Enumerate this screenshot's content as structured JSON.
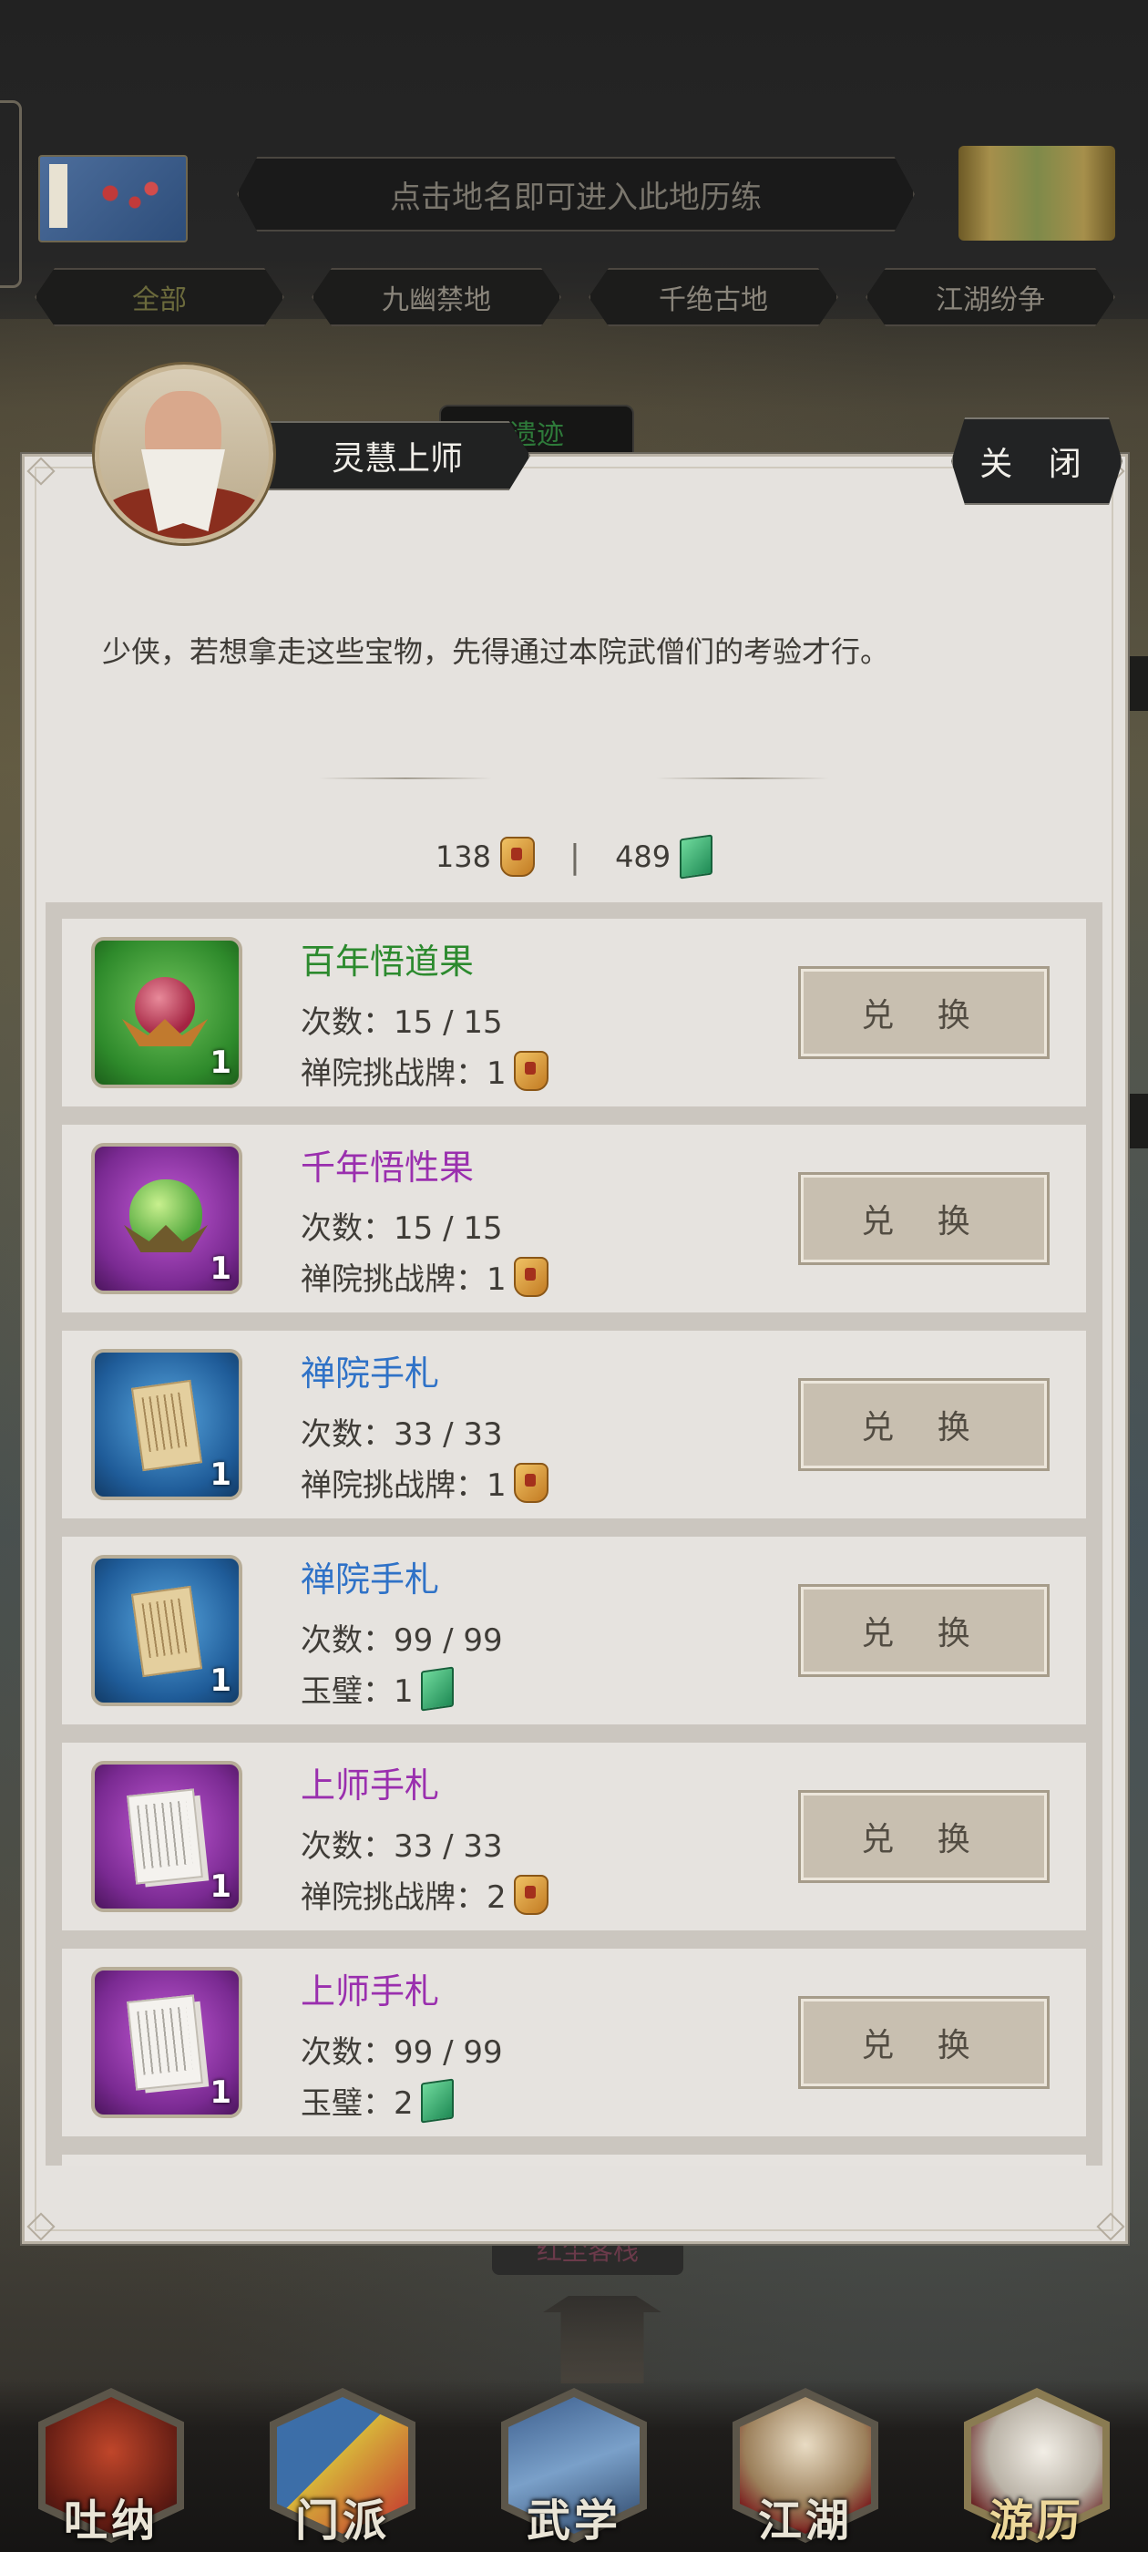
{
  "header": {
    "banner_text": "点击地名即可进入此地历练",
    "region_tabs": [
      "全部",
      "九幽禁地",
      "千绝古地",
      "江湖纷争"
    ]
  },
  "background": {
    "tag_behind": "遗迹",
    "tag_bottom": "红尘客栈"
  },
  "dialog": {
    "npc_name": "灵慧上师",
    "close_label": "关 闭",
    "message": "少侠，若想拿走这些宝物，先得通过本院武僧们的考验才行。",
    "currency": {
      "tokens": "138",
      "tokens_icon": "challenge-token-icon",
      "separator": "|",
      "jade": "489",
      "jade_icon": "jade-icon"
    },
    "items": [
      {
        "name": "百年悟道果",
        "rarity_color": "green",
        "icon": "red-fruit-icon",
        "qty": "1",
        "count_label": "次数：15 / 15",
        "cost_label": "禅院挑战牌：1",
        "cost_icon": "challenge-token-icon",
        "button": "兑 换"
      },
      {
        "name": "千年悟性果",
        "rarity_color": "purple",
        "icon": "green-fruit-icon",
        "qty": "1",
        "count_label": "次数：15 / 15",
        "cost_label": "禅院挑战牌：1",
        "cost_icon": "challenge-token-icon",
        "button": "兑 换"
      },
      {
        "name": "禅院手札",
        "rarity_color": "blue",
        "icon": "scroll-notes-icon",
        "qty": "1",
        "count_label": "次数：33 / 33",
        "cost_label": "禅院挑战牌：1",
        "cost_icon": "challenge-token-icon",
        "button": "兑 换"
      },
      {
        "name": "禅院手札",
        "rarity_color": "blue",
        "icon": "scroll-notes-icon",
        "qty": "1",
        "count_label": "次数：99 / 99",
        "cost_label": "玉璧：1",
        "cost_icon": "jade-icon",
        "button": "兑 换"
      },
      {
        "name": "上师手札",
        "rarity_color": "purple",
        "icon": "paper-notes-icon",
        "qty": "1",
        "count_label": "次数：33 / 33",
        "cost_label": "禅院挑战牌：2",
        "cost_icon": "challenge-token-icon",
        "button": "兑 换"
      },
      {
        "name": "上师手札",
        "rarity_color": "purple",
        "icon": "paper-notes-icon",
        "qty": "1",
        "count_label": "次数：99 / 99",
        "cost_label": "玉璧：2",
        "cost_icon": "jade-icon",
        "button": "兑 换"
      }
    ]
  },
  "bottom_nav": {
    "items": [
      {
        "label": "吐纳",
        "icon": "meditation-icon"
      },
      {
        "label": "门派",
        "icon": "sect-banner-icon"
      },
      {
        "label": "武学",
        "icon": "martial-book-icon"
      },
      {
        "label": "江湖",
        "icon": "bamboo-hat-icon"
      },
      {
        "label": "游历",
        "icon": "horse-icon"
      }
    ],
    "active_index": 4
  }
}
